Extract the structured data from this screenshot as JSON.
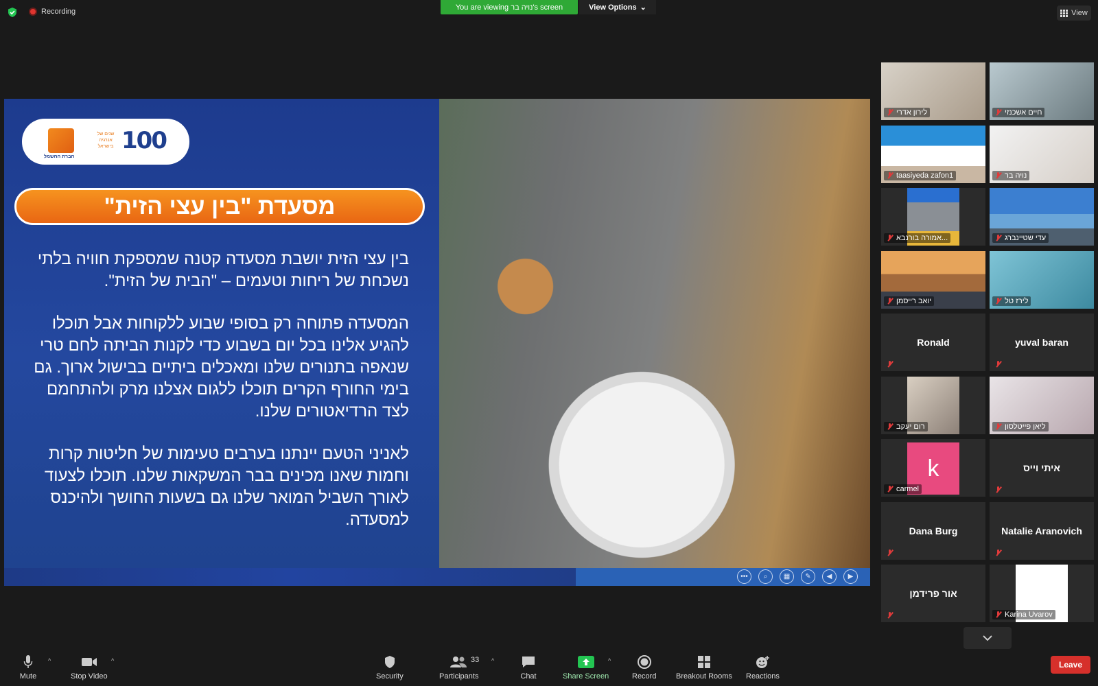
{
  "topbar": {
    "recording_label": "Recording",
    "viewing_label": "You are viewing נויה בר's screen",
    "view_options_label": "View Options",
    "view_label": "View"
  },
  "slide": {
    "logo_number": "100",
    "logo_small_text": "שנים של אנרגיה בישראל",
    "logo_company_text": "חברת החשמל",
    "title": "מסעדת \"בין עצי הזית\"",
    "paragraphs": [
      "בין עצי הזית יושבת מסעדה קטנה שמספקת חוויה בלתי נשכחת של ריחות וטעמים – \"הבית של הזית\".",
      "המסעדה פתוחה רק בסופי שבוע ללקוחות אבל תוכלו להגיע אלינו בכל יום בשבוע כדי לקנות הביתה לחם טרי שנאפה בתנורים שלנו ומאכלים ביתיים בבישול ארוך. גם בימי החורף הקרים תוכלו ללגום אצלנו מרק ולהתחמם לצד הרדיאטורים שלנו.",
      "לאניני הטעם יינתנו בערבים טעימות של חליטות קרות וחמות שאנו מכינים בבר המשקאות שלנו. תוכלו לצעוד לאורך השביל המואר שלנו גם בשעות החושך ולהיכנס למסעדה."
    ]
  },
  "participants": [
    {
      "name": "לירון אדרי",
      "type": "video"
    },
    {
      "name": "חיים אשכנזי",
      "type": "video"
    },
    {
      "name": "taasiyeda zafon1",
      "type": "video"
    },
    {
      "name": "נויה בר",
      "type": "video"
    },
    {
      "name": "אמורה בורנבא...",
      "type": "video"
    },
    {
      "name": "עדי שטיינברג",
      "type": "video"
    },
    {
      "name": "יואב רייסמן",
      "type": "video"
    },
    {
      "name": "לירז טל",
      "type": "video"
    },
    {
      "name": "Ronald",
      "type": "name"
    },
    {
      "name": "yuval baran",
      "type": "name"
    },
    {
      "name": "רום יעקב",
      "type": "video"
    },
    {
      "name": "ליאן פייטלסון",
      "type": "video"
    },
    {
      "name": "carmel",
      "type": "avatar",
      "avatar_letter": "k"
    },
    {
      "name": "איתי וייס",
      "type": "name"
    },
    {
      "name": "Dana Burg",
      "type": "name"
    },
    {
      "name": "Natalie Aranovich",
      "type": "name"
    },
    {
      "name": "אור פרידמן",
      "type": "name"
    },
    {
      "name": "Karina Uvarov",
      "type": "video"
    }
  ],
  "toolbar": {
    "mute": "Mute",
    "stop_video": "Stop Video",
    "security": "Security",
    "participants": "Participants",
    "participants_count": "33",
    "chat": "Chat",
    "share_screen": "Share Screen",
    "record": "Record",
    "breakout_rooms": "Breakout Rooms",
    "reactions": "Reactions",
    "leave": "Leave"
  },
  "colors": {
    "viewing_bar": "#2fa936",
    "leave": "#d6302b",
    "active_speaker": "#e5eb4a",
    "share_screen": "#23c552"
  }
}
